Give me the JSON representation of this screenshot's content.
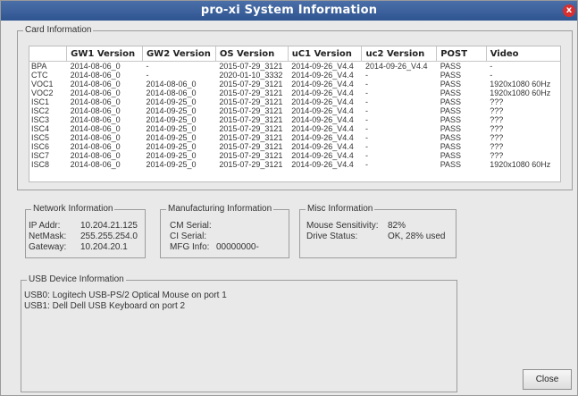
{
  "window": {
    "title": "pro-xi System Information",
    "close_glyph": "x"
  },
  "card_info": {
    "title": "Card Information",
    "columns": [
      "",
      "GW1 Version",
      "GW2 Version",
      "OS Version",
      "uC1 Version",
      "uc2 Version",
      "POST",
      "Video"
    ],
    "rows": [
      [
        "BPA",
        "2014-08-06_0",
        "-",
        "2015-07-29_3121",
        "2014-09-26_V4.4",
        "2014-09-26_V4.4",
        "PASS",
        "-"
      ],
      [
        "CTC",
        "2014-08-06_0",
        "-",
        "2020-01-10_3332",
        "2014-09-26_V4.4",
        "-",
        "PASS",
        "-"
      ],
      [
        "VOC1",
        "2014-08-06_0",
        "2014-08-06_0",
        "2015-07-29_3121",
        "2014-09-26_V4.4",
        "-",
        "PASS",
        "1920x1080 60Hz"
      ],
      [
        "VOC2",
        "2014-08-06_0",
        "2014-08-06_0",
        "2015-07-29_3121",
        "2014-09-26_V4.4",
        "-",
        "PASS",
        "1920x1080 60Hz"
      ],
      [
        "ISC1",
        "2014-08-06_0",
        "2014-09-25_0",
        "2015-07-29_3121",
        "2014-09-26_V4.4",
        "-",
        "PASS",
        "???"
      ],
      [
        "ISC2",
        "2014-08-06_0",
        "2014-09-25_0",
        "2015-07-29_3121",
        "2014-09-26_V4.4",
        "-",
        "PASS",
        "???"
      ],
      [
        "ISC3",
        "2014-08-06_0",
        "2014-09-25_0",
        "2015-07-29_3121",
        "2014-09-26_V4.4",
        "-",
        "PASS",
        "???"
      ],
      [
        "ISC4",
        "2014-08-06_0",
        "2014-09-25_0",
        "2015-07-29_3121",
        "2014-09-26_V4.4",
        "-",
        "PASS",
        "???"
      ],
      [
        "ISC5",
        "2014-08-06_0",
        "2014-09-25_0",
        "2015-07-29_3121",
        "2014-09-26_V4.4",
        "-",
        "PASS",
        "???"
      ],
      [
        "ISC6",
        "2014-08-06_0",
        "2014-09-25_0",
        "2015-07-29_3121",
        "2014-09-26_V4.4",
        "-",
        "PASS",
        "???"
      ],
      [
        "ISC7",
        "2014-08-06_0",
        "2014-09-25_0",
        "2015-07-29_3121",
        "2014-09-26_V4.4",
        "-",
        "PASS",
        "???"
      ],
      [
        "ISC8",
        "2014-08-06_0",
        "2014-09-25_0",
        "2015-07-29_3121",
        "2014-09-26_V4.4",
        "-",
        "PASS",
        "1920x1080 60Hz"
      ]
    ]
  },
  "network": {
    "title": "Network Information",
    "ip_label": "IP Addr:",
    "ip_value": "10.204.21.125",
    "mask_label": "NetMask:",
    "mask_value": "255.255.254.0",
    "gateway_label": "Gateway:",
    "gateway_value": "10.204.20.1"
  },
  "manufacturing": {
    "title": "Manufacturing Information",
    "cm_label": "CM Serial:",
    "ci_label": "CI Serial:",
    "mfg_label": "MFG Info:",
    "mfg_value": "00000000-"
  },
  "misc": {
    "title": "Misc Information",
    "mouse_label": "Mouse Sensitivity:",
    "mouse_value": "82%",
    "drive_label": "Drive Status:",
    "drive_value": "OK, 28% used"
  },
  "usb": {
    "title": "USB Device Information",
    "lines": [
      "USB0:  Logitech USB-PS/2 Optical Mouse on port 1",
      "USB1:  Dell Dell USB Keyboard on port 2"
    ]
  },
  "buttons": {
    "close": "Close"
  }
}
